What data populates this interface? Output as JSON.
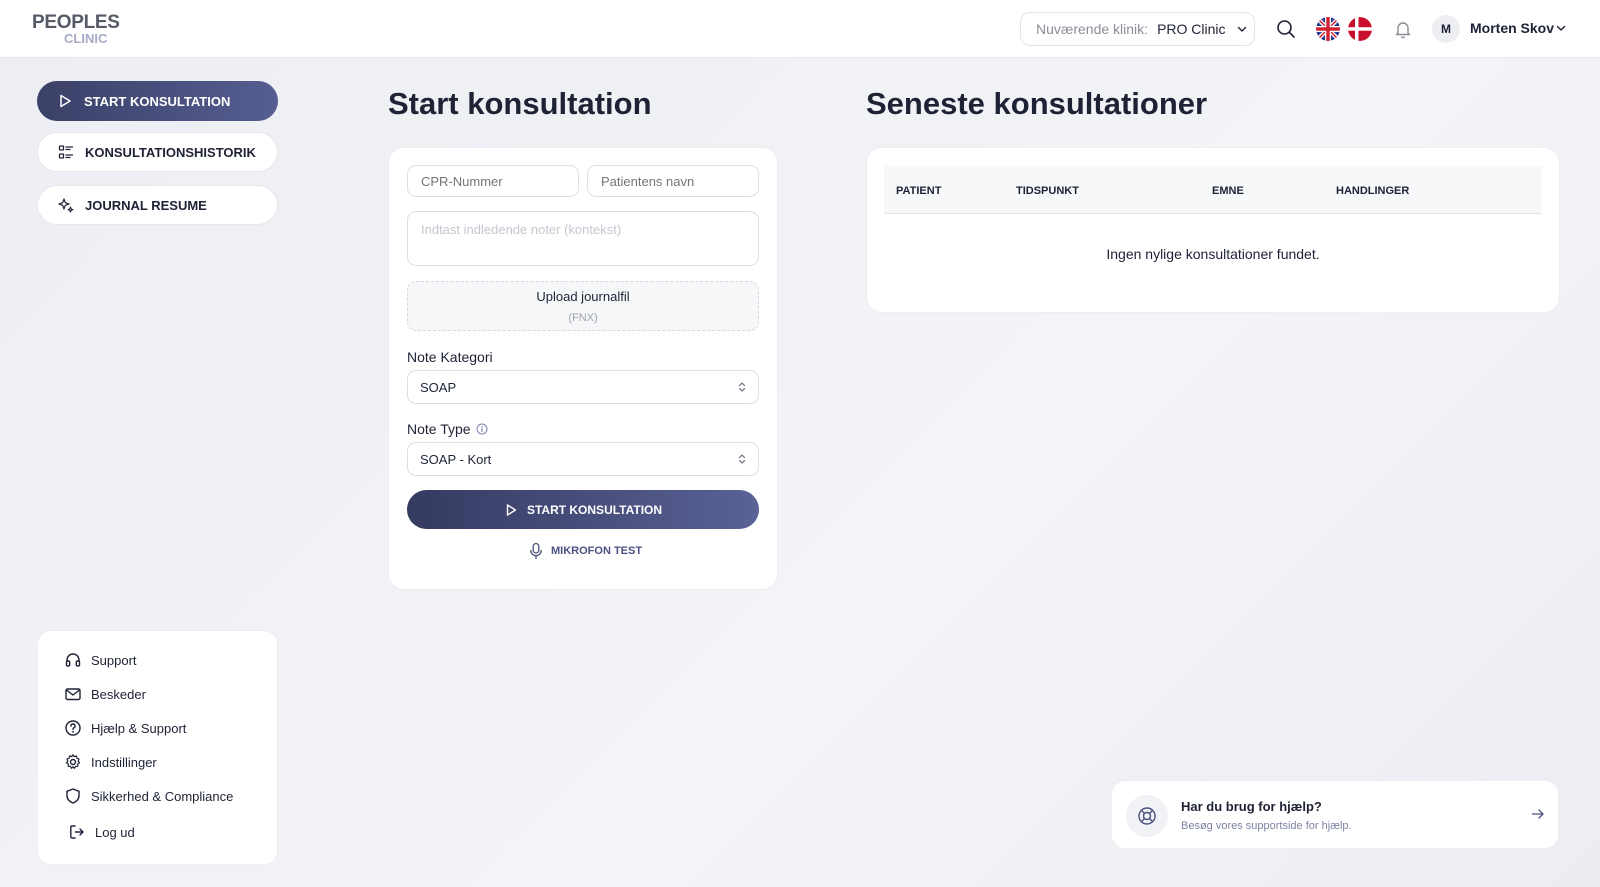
{
  "brand": {
    "logo_line1": "PEOPLES",
    "logo_line2": "CLINIC"
  },
  "header": {
    "clinic_label": "Nuværende klinik:",
    "clinic_value": "PRO Clinic",
    "avatar_initial": "M",
    "user_name": "Morten Skov"
  },
  "sidebar": {
    "nav": [
      {
        "label": "START KONSULTATION",
        "icon": "play-icon",
        "active": true
      },
      {
        "label": "KONSULTATIONSHISTORIK",
        "icon": "list-icon",
        "active": false
      },
      {
        "label": "JOURNAL RESUME",
        "icon": "sparkles-icon",
        "active": false
      }
    ],
    "links": [
      {
        "label": "Support",
        "icon": "headphones-icon"
      },
      {
        "label": "Beskeder",
        "icon": "mail-icon"
      },
      {
        "label": "Hjælp & Support",
        "icon": "help-circle-icon"
      },
      {
        "label": "Indstillinger",
        "icon": "gear-icon"
      },
      {
        "label": "Sikkerhed & Compliance",
        "icon": "shield-icon"
      },
      {
        "label": "Log ud",
        "icon": "logout-icon"
      }
    ]
  },
  "consultation": {
    "title": "Start konsultation",
    "cpr_placeholder": "CPR-Nummer",
    "name_placeholder": "Patientens navn",
    "notes_placeholder": "Indtast indledende noter (kontekst)",
    "upload_label": "Upload journalfil",
    "upload_hint": "(FNX)",
    "note_category_label": "Note Kategori",
    "note_category_value": "SOAP",
    "note_type_label": "Note Type",
    "note_type_value": "SOAP - Kort",
    "start_button": "START KONSULTATION",
    "mic_test": "MIKROFON TEST"
  },
  "recent": {
    "title": "Seneste konsultationer",
    "columns": [
      "PATIENT",
      "TIDSPUNKT",
      "EMNE",
      "HANDLINGER"
    ],
    "empty_message": "Ingen nylige konsultationer fundet."
  },
  "help": {
    "title": "Har du brug for hjælp?",
    "subtitle": "Besøg vores supportside for hjælp."
  },
  "colors": {
    "primary": "#3a4066",
    "primary_light": "#565e92",
    "text": "#1e2235",
    "muted": "#8b8e98"
  }
}
